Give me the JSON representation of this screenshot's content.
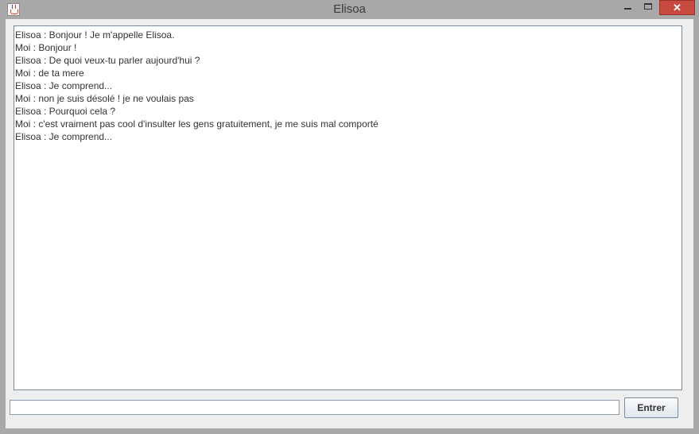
{
  "window": {
    "title": "Elisoa",
    "close_glyph": "✕",
    "icons": [
      "java-cup-icon",
      "minimize-icon",
      "maximize-icon",
      "close-icon"
    ]
  },
  "chat": {
    "lines": [
      "Elisoa : Bonjour ! Je m'appelle Elisoa.",
      "Moi : Bonjour !",
      "Elisoa : De quoi veux-tu parler aujourd'hui ?",
      "Moi : de ta mere",
      "Elisoa : Je comprend...",
      "Moi : non je suis désolé ! je ne voulais pas",
      "Elisoa : Pourquoi cela ?",
      "Moi : c'est vraiment pas cool d'insulter les gens gratuitement, je me suis mal comporté",
      "Elisoa : Je comprend..."
    ]
  },
  "input": {
    "value": "",
    "placeholder": ""
  },
  "send_button": {
    "label": "Entrer"
  },
  "colors": {
    "titlebar": "#a8a8a8",
    "close_button": "#c7493f",
    "client_background": "#eeeeee"
  }
}
